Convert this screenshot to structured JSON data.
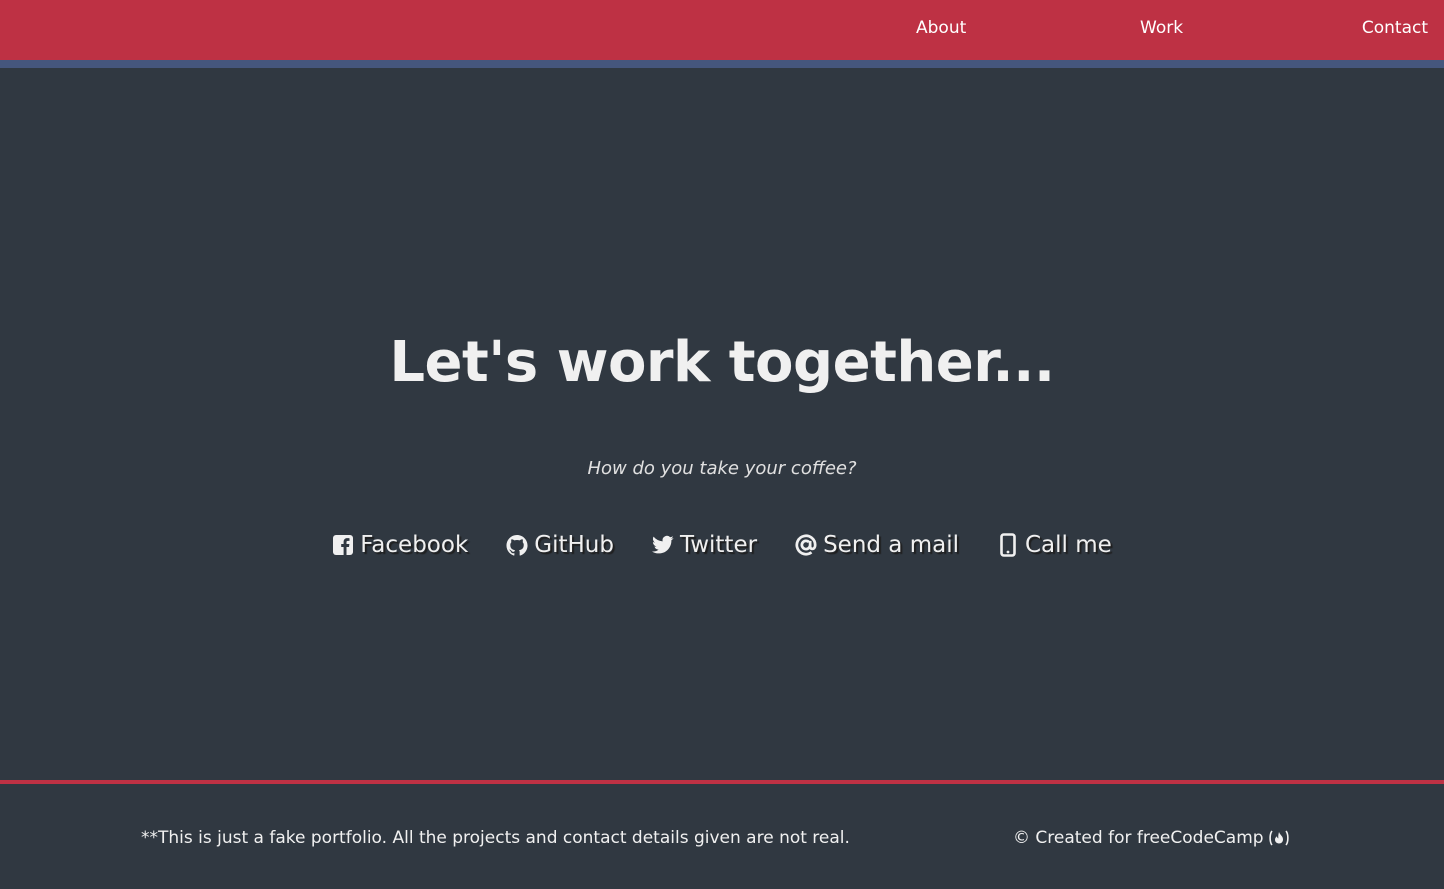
{
  "nav": {
    "about": "About",
    "work": "Work",
    "contact": "Contact"
  },
  "contact": {
    "headline": "Let's work together...",
    "subtitle": "How do you take your coffee?",
    "links": [
      {
        "label": "Facebook",
        "icon": "facebook-square-icon"
      },
      {
        "label": "GitHub",
        "icon": "github-icon"
      },
      {
        "label": "Twitter",
        "icon": "twitter-icon"
      },
      {
        "label": "Send a mail",
        "icon": "at-icon"
      },
      {
        "label": "Call me",
        "icon": "mobile-phone-icon"
      }
    ]
  },
  "footer": {
    "note": "**This is just a fake portfolio. All the projects and contact details given are not real.",
    "credit": "© Created for freeCodeCamp",
    "credit_icon": "freecodecamp-fire-icon"
  },
  "colors": {
    "navbar": "#be3144",
    "navbar_border": "#45567d",
    "background": "#303841",
    "text": "#f0f0f0",
    "footer_border": "#be3144"
  }
}
